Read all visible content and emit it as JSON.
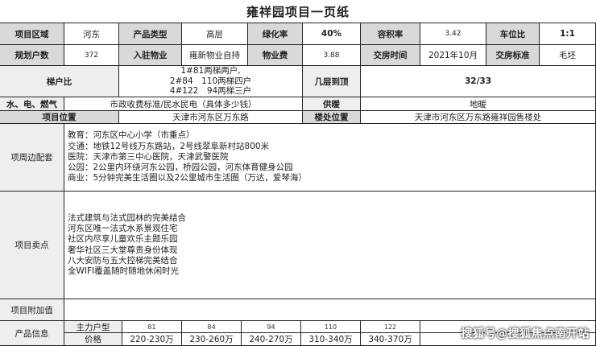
{
  "title": "雍祥园项目一页纸",
  "row1": {
    "area_label": "项目区域",
    "area_value": "河东",
    "type_label": "产品类型",
    "type_value": "高层",
    "green_label": "绿化率",
    "green_value": "40%",
    "far_label": "容积率",
    "far_value": "3.42",
    "parking_label": "车位比",
    "parking_value": "1:1"
  },
  "row2": {
    "households_label": "规划户数",
    "households_value": "372",
    "property_label": "入驻物业",
    "property_value": "雍新物业自持",
    "fee_label": "物业费",
    "fee_value": "3.88",
    "delivery_label": "交房时间",
    "delivery_value": "2021年10月",
    "standard_label": "交房标准",
    "standard_value": "毛坯"
  },
  "row3": {
    "elevator_label": "梯户比",
    "elevator_lines": [
      "1#81两梯两户,",
      "2#84　110两梯四户",
      "4#122　94两梯三户"
    ],
    "floors_label": "几层到顶",
    "floors_value": "32/33"
  },
  "row4": {
    "utilities_label": "水、电、燃气",
    "utilities_value": "市政收费标准/民水民电（具体多少钱）",
    "heating_label": "供暖",
    "heating_value": "地暖"
  },
  "row5": {
    "location_label": "项目位置",
    "location_value": "天津市河东区万东路",
    "sales_label": "楼处位置",
    "sales_value": "天津市河东区万东路雍祥园售楼处"
  },
  "surroundings": {
    "label": "项周边配套",
    "lines": [
      "教育：河东区中心小学（市重点）",
      "交通：地铁12号线万东路站，2号线翠阜新村站800米",
      "医院：天津市第三中心医院，天津武警医院",
      "公园：2公里内环绕河东公园，桥园公园，河东体育健身公园",
      "商业：5分钟完美生活圈以及2公里城市生活圈（万达，爱琴海）"
    ]
  },
  "selling_points": {
    "label": "项目卖点",
    "lines": [
      "法式建筑与法式园林的完美结合",
      "河东区唯一法式水系景观住宅",
      "社区内尽享儿童欢乐主题乐园",
      "奢华社区三大堂尊贵身份体现",
      "八大安防与五大控梯完美结合",
      "全WIFI覆盖随时随地休闲时光"
    ]
  },
  "added_value": {
    "label": "项目附加值",
    "value": ""
  },
  "products": {
    "label": "产品信息",
    "type_label": "主力户型",
    "price_label": "价格",
    "sizes": [
      "81",
      "84",
      "94",
      "110",
      "122"
    ],
    "prices": [
      "220-230万",
      "230-260万",
      "240-270万",
      "310-340万",
      "340-370万"
    ]
  },
  "watermark": "搜狐号@搜狐焦点南开站"
}
